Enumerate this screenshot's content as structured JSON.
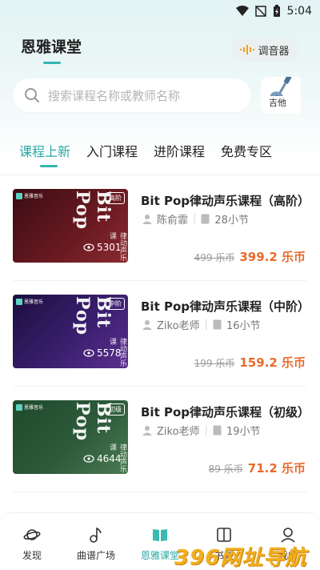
{
  "status_bar": {
    "time": "5:04"
  },
  "header": {
    "app_title": "恩雅课堂",
    "tuner_label": "调音器"
  },
  "search": {
    "placeholder": "搜索课程名称或教师名称"
  },
  "guitar_shortcut": {
    "label": "吉他"
  },
  "tabs": [
    {
      "label": "课程上新",
      "active": true
    },
    {
      "label": "入门课程",
      "active": false
    },
    {
      "label": "进阶课程",
      "active": false
    },
    {
      "label": "免费专区",
      "active": false
    }
  ],
  "courses": [
    {
      "title": "Bit Pop律动声乐课程（高阶）",
      "teacher": "陈俞霏",
      "lessons": "28小节",
      "original_price": "499 乐币",
      "price": "399.2 乐币",
      "thumb": {
        "brand": "恩雅音乐",
        "level": "高阶",
        "big_text": "Bit Pop",
        "cn_text": "律动声乐课",
        "views": "5301",
        "color": "#6b1a22"
      }
    },
    {
      "title": "Bit Pop律动声乐课程（中阶）",
      "teacher": "Ziko老师",
      "lessons": "16小节",
      "original_price": "199 乐币",
      "price": "159.2 乐币",
      "thumb": {
        "brand": "恩雅音乐",
        "level": "中阶",
        "big_text": "Bit Pop",
        "cn_text": "律动声乐课",
        "views": "5578",
        "color": "#3a1f6e"
      }
    },
    {
      "title": "Bit Pop律动声乐课程（初级）",
      "teacher": "Ziko老师",
      "lessons": "19小节",
      "original_price": "89 乐币",
      "price": "71.2 乐币",
      "thumb": {
        "brand": "恩雅音乐",
        "level": "初级",
        "big_text": "Bit Pop",
        "cn_text": "律动声乐课",
        "views": "4644",
        "color": "#2d5a3a"
      }
    }
  ],
  "bottom_nav": [
    {
      "label": "发现",
      "icon": "planet-icon",
      "active": false
    },
    {
      "label": "曲谱广场",
      "icon": "music-note-icon",
      "active": false
    },
    {
      "label": "恩雅课堂",
      "icon": "book-icon",
      "active": true
    },
    {
      "label": "书架",
      "icon": "bookshelf-icon",
      "active": false
    },
    {
      "label": "我的",
      "icon": "user-icon",
      "active": false
    }
  ],
  "watermark": {
    "text": "396网址导航"
  },
  "colors": {
    "accent": "#2aa8a2",
    "price": "#e86a2c"
  }
}
